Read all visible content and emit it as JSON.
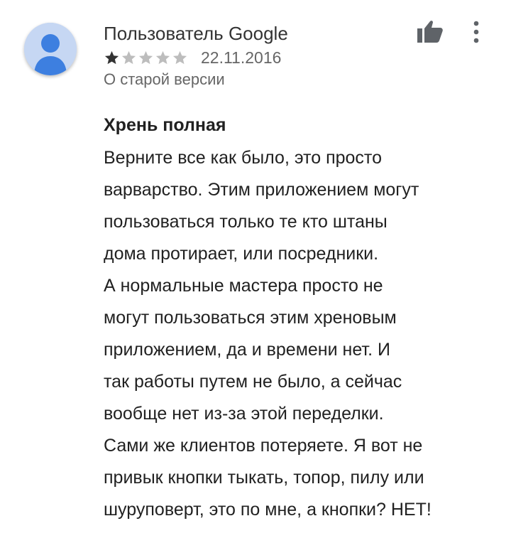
{
  "review": {
    "author": "Пользователь Google",
    "rating": 1,
    "max_rating": 5,
    "date": "22.11.2016",
    "version_note": "О старой версии",
    "title": "Хрень полная",
    "body_lines": [
      "Верните все как было, это просто",
      "варварство. Этим приложением могут",
      "пользоваться только те кто штаны",
      "дома протирает, или посредники.",
      "А нормальные мастера просто не",
      "могут пользоваться этим хреновым",
      "приложением, да и времени нет. И",
      "так работы путем не было, а сейчас",
      "вообще нет из-за этой переделки.",
      "Сами же клиентов потеряете. Я вот не",
      "привык кнопки тыкать, топор, пилу или",
      "шуруповерт, это по мне, а кнопки? НЕТ!"
    ]
  },
  "icons": {
    "avatar": "default-user-avatar",
    "helpful": "thumbs-up-icon",
    "menu": "more-vert-icon",
    "star_filled": "star-filled-icon",
    "star_empty": "star-empty-icon"
  },
  "colors": {
    "avatar_bg": "#c6d7f3",
    "avatar_figure": "#3d7fe0",
    "star_filled": "#333333",
    "star_empty": "#bdbdbd",
    "icon": "#5f6368",
    "secondary_text": "#666666",
    "primary_text": "#212121"
  }
}
